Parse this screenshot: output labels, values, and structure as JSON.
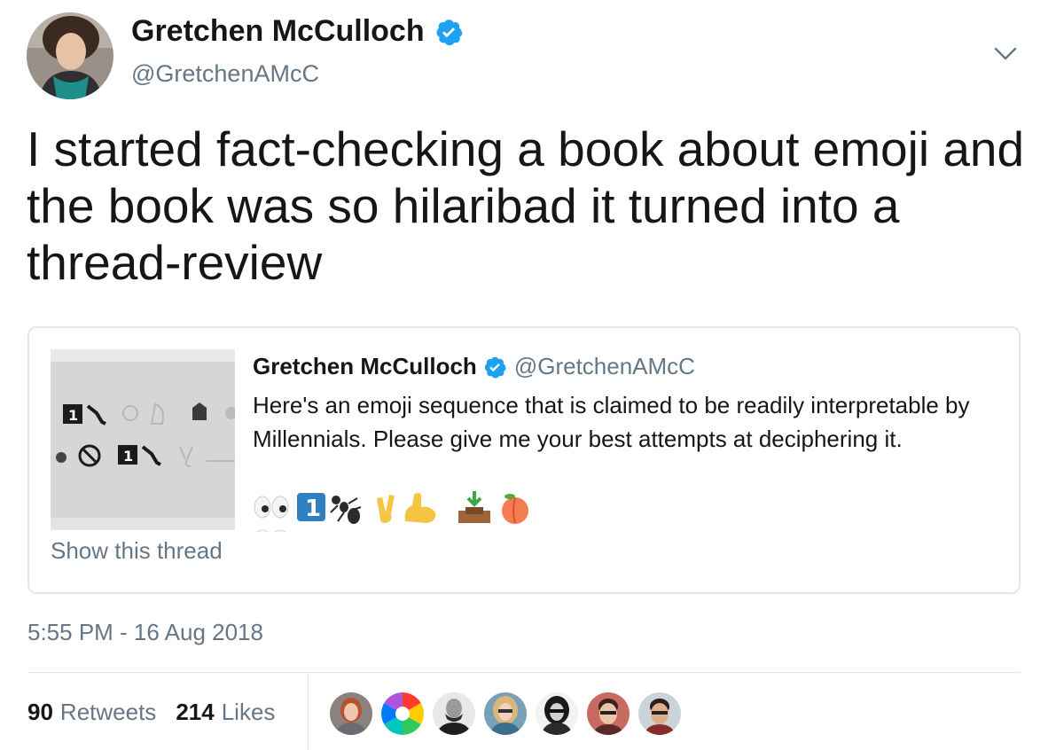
{
  "author": {
    "name": "Gretchen McCulloch",
    "handle": "@GretchenAMcC"
  },
  "tweet": {
    "text": "I started fact-checking a book about emoji and the book was so hilaribad it turned into a thread-review"
  },
  "quote": {
    "name": "Gretchen McCulloch",
    "handle": "@GretchenAMcC",
    "text": "Here's an emoji sequence that is claimed to be readily interpretable by Millennials. Please give me your best attempts at deciphering it.",
    "show_thread": "Show this thread"
  },
  "timestamp": "5:55 PM - 16 Aug 2018",
  "stats": {
    "retweets_count": "90",
    "retweets_label": "Retweets",
    "likes_count": "214",
    "likes_label": "Likes"
  },
  "icons": {
    "verified": "verified-badge-icon",
    "caret": "chevron-down-icon",
    "emoji_sequence": [
      "eyes-icon",
      "keycap-one-icon",
      "ant-icon",
      "victory-hand-icon",
      "flexed-biceps-icon",
      "inbox-tray-icon",
      "peach-icon"
    ]
  },
  "colors": {
    "text": "#14171a",
    "muted": "#657786",
    "border": "#e1e8ed",
    "verified": "#1da1f2"
  }
}
